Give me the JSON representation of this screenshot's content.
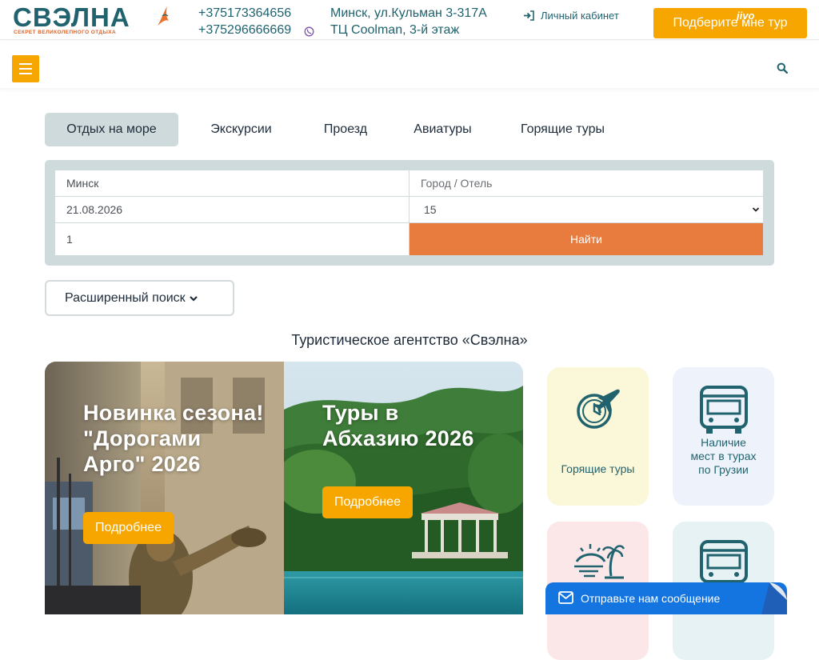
{
  "brand": {
    "name": "СВЭЛНА",
    "tagline": "СЕКРЕТ ВЕЛИКОЛЕПНОГО ОТДЫХА",
    "accent": "#20636f",
    "orange": "#f7a600"
  },
  "header": {
    "phone1": "+375173364656",
    "phone2": "+375296666669",
    "address1": "Минск, ул.Кульман 3-317А",
    "address2": "ТЦ Coolman, 3-й этаж",
    "cabinet_label": "Личный кабинет",
    "cta_label": "Подберите мне тур"
  },
  "tabs": [
    {
      "label": "Отдых на море",
      "active": true
    },
    {
      "label": "Экскурсии",
      "active": false
    },
    {
      "label": "Проезд",
      "active": false
    },
    {
      "label": "Авиатуры",
      "active": false
    },
    {
      "label": "Горящие туры",
      "active": false
    }
  ],
  "search": {
    "from_city": "Минск",
    "destination_placeholder": "Город / Отель",
    "date": "21.08.2026",
    "nights": "15",
    "tourists": "1",
    "submit_label": "Найти"
  },
  "advanced_search_label": "Расширенный поиск",
  "agency_title": "Туристическое агентство «Свэлна»",
  "slides": [
    {
      "title": "Новинка сезона! \"Дорогами Арго\" 2026",
      "button": "Подробнее"
    },
    {
      "title": "Туры в Абхазию 2026",
      "button": "Подробнее"
    }
  ],
  "tiles": [
    {
      "label": "Горящие туры",
      "icon": "clock-plane-icon"
    },
    {
      "label": "Наличие мест в турах по Грузии",
      "icon": "bus-icon"
    },
    {
      "label": "",
      "icon": "beach-icon"
    },
    {
      "label": "",
      "icon": "bus-icon"
    }
  ],
  "chat": {
    "label": "Отправьте нам сообщение",
    "brand": "jivo"
  }
}
